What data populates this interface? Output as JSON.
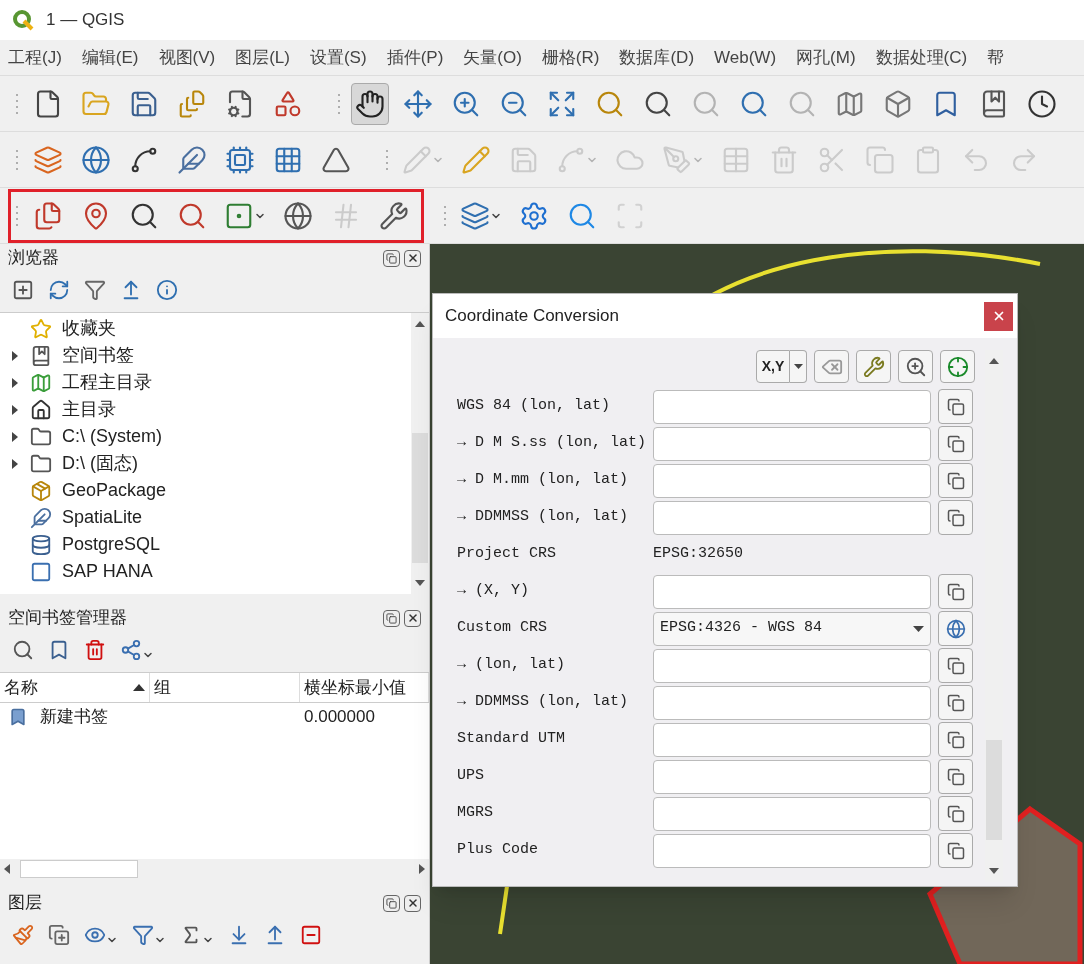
{
  "window": {
    "title": "1 — QGIS"
  },
  "menu": [
    "工程(J)",
    "编辑(E)",
    "视图(V)",
    "图层(L)",
    "设置(S)",
    "插件(P)",
    "矢量(O)",
    "栅格(R)",
    "数据库(D)",
    "Web(W)",
    "网孔(M)",
    "数据处理(C)",
    "帮"
  ],
  "toolbar_rows": [
    {
      "groups": [
        {
          "highlighted": false,
          "items": [
            {
              "selected": false,
              "disabled": false
            },
            {
              "selected": false,
              "disabled": false
            },
            {
              "selected": false,
              "disabled": false
            },
            {
              "selected": false,
              "disabled": false
            },
            {
              "selected": false,
              "disabled": false
            },
            {
              "selected": false,
              "disabled": false
            }
          ]
        },
        {
          "highlighted": false,
          "items": [
            {
              "selected": true,
              "disabled": false
            },
            {
              "selected": false,
              "disabled": false
            },
            {
              "selected": false,
              "disabled": false
            },
            {
              "selected": false,
              "disabled": false
            },
            {
              "selected": false,
              "disabled": false
            },
            {
              "selected": false,
              "disabled": false
            },
            {
              "selected": false,
              "disabled": false
            },
            {
              "selected": false,
              "disabled": true
            },
            {
              "selected": false,
              "disabled": false
            },
            {
              "selected": false,
              "disabled": true
            },
            {
              "selected": false,
              "disabled": false
            },
            {
              "selected": false,
              "disabled": false
            },
            {
              "selected": false,
              "disabled": false
            },
            {
              "selected": false,
              "disabled": false
            },
            {
              "selected": false,
              "disabled": false
            }
          ]
        }
      ]
    },
    {
      "groups": [
        {
          "highlighted": false,
          "items": [
            {
              "selected": false,
              "disabled": false
            },
            {
              "selected": false,
              "disabled": false
            },
            {
              "selected": false,
              "disabled": false
            },
            {
              "selected": false,
              "disabled": false
            },
            {
              "selected": false,
              "disabled": false
            },
            {
              "selected": false,
              "disabled": false
            },
            {
              "selected": false,
              "disabled": false
            }
          ]
        },
        {
          "highlighted": false,
          "items": [
            {
              "selected": false,
              "disabled": true
            },
            {
              "selected": false,
              "disabled": false
            },
            {
              "selected": false,
              "disabled": true
            },
            {
              "selected": false,
              "disabled": true
            },
            {
              "selected": false,
              "disabled": true
            },
            {
              "selected": false,
              "disabled": true
            },
            {
              "selected": false,
              "disabled": true
            },
            {
              "selected": false,
              "disabled": true
            },
            {
              "selected": false,
              "disabled": true
            },
            {
              "selected": false,
              "disabled": true
            },
            {
              "selected": false,
              "disabled": true
            },
            {
              "selected": false,
              "disabled": true
            },
            {
              "selected": false,
              "disabled": true
            }
          ]
        }
      ]
    },
    {
      "groups": [
        {
          "highlighted": true,
          "items": [
            {
              "selected": false,
              "disabled": false
            },
            {
              "selected": false,
              "disabled": false
            },
            {
              "selected": false,
              "disabled": false
            },
            {
              "selected": false,
              "disabled": false
            },
            {
              "selected": false,
              "disabled": false
            },
            {
              "selected": false,
              "disabled": false
            },
            {
              "selected": false,
              "disabled": true
            },
            {
              "selected": false,
              "disabled": false
            }
          ]
        },
        {
          "highlighted": false,
          "items": [
            {
              "selected": false,
              "disabled": false
            },
            {
              "selected": false,
              "disabled": false
            },
            {
              "selected": false,
              "disabled": false
            },
            {
              "selected": false,
              "disabled": true
            }
          ]
        }
      ]
    }
  ],
  "browser": {
    "title": "浏览器",
    "items": [
      {
        "label": "收藏夹",
        "kind": "leaf"
      },
      {
        "label": "空间书签",
        "kind": "collapsible"
      },
      {
        "label": "工程主目录",
        "kind": "collapsible"
      },
      {
        "label": "主目录",
        "kind": "collapsible"
      },
      {
        "label": "C:\\ (System)",
        "kind": "collapsible"
      },
      {
        "label": "D:\\ (固态)",
        "kind": "collapsible"
      },
      {
        "label": "GeoPackage",
        "kind": "leaf"
      },
      {
        "label": "SpatiaLite",
        "kind": "leaf"
      },
      {
        "label": "PostgreSQL",
        "kind": "leaf"
      },
      {
        "label": "SAP HANA",
        "kind": "leaf"
      }
    ]
  },
  "bookmarks": {
    "title": "空间书签管理器",
    "columns": [
      {
        "label": "名称",
        "sorted": true
      },
      {
        "label": "组",
        "sorted": false
      },
      {
        "label": "横坐标最小值",
        "sorted": false
      }
    ],
    "rows": [
      [
        "新建书签",
        "",
        "0.000000"
      ]
    ]
  },
  "layers": {
    "title": "图层"
  },
  "dialog": {
    "title": "Coordinate Conversion",
    "format_button": "X,Y",
    "rows": [
      {
        "kind": "field",
        "label": "WGS 84 (lon, lat)"
      },
      {
        "kind": "field",
        "label": "→ D M S.ss (lon, lat)"
      },
      {
        "kind": "field",
        "label": "→ D M.mm (lon, lat)"
      },
      {
        "kind": "field",
        "label": "→ DDMMSS (lon, lat)"
      },
      {
        "kind": "info",
        "label": "Project CRS",
        "value": "EPSG:32650"
      },
      {
        "kind": "field",
        "label": "→ (X, Y)"
      },
      {
        "kind": "select",
        "label": "Custom CRS",
        "value": "EPSG:4326 - WGS 84"
      },
      {
        "kind": "field",
        "label": "→ (lon, lat)"
      },
      {
        "kind": "field",
        "label": "→ DDMMSS (lon, lat)"
      },
      {
        "kind": "field",
        "label": "Standard UTM"
      },
      {
        "kind": "field",
        "label": "UPS"
      },
      {
        "kind": "field",
        "label": "MGRS"
      },
      {
        "kind": "field",
        "label": "Plus Code"
      }
    ]
  }
}
